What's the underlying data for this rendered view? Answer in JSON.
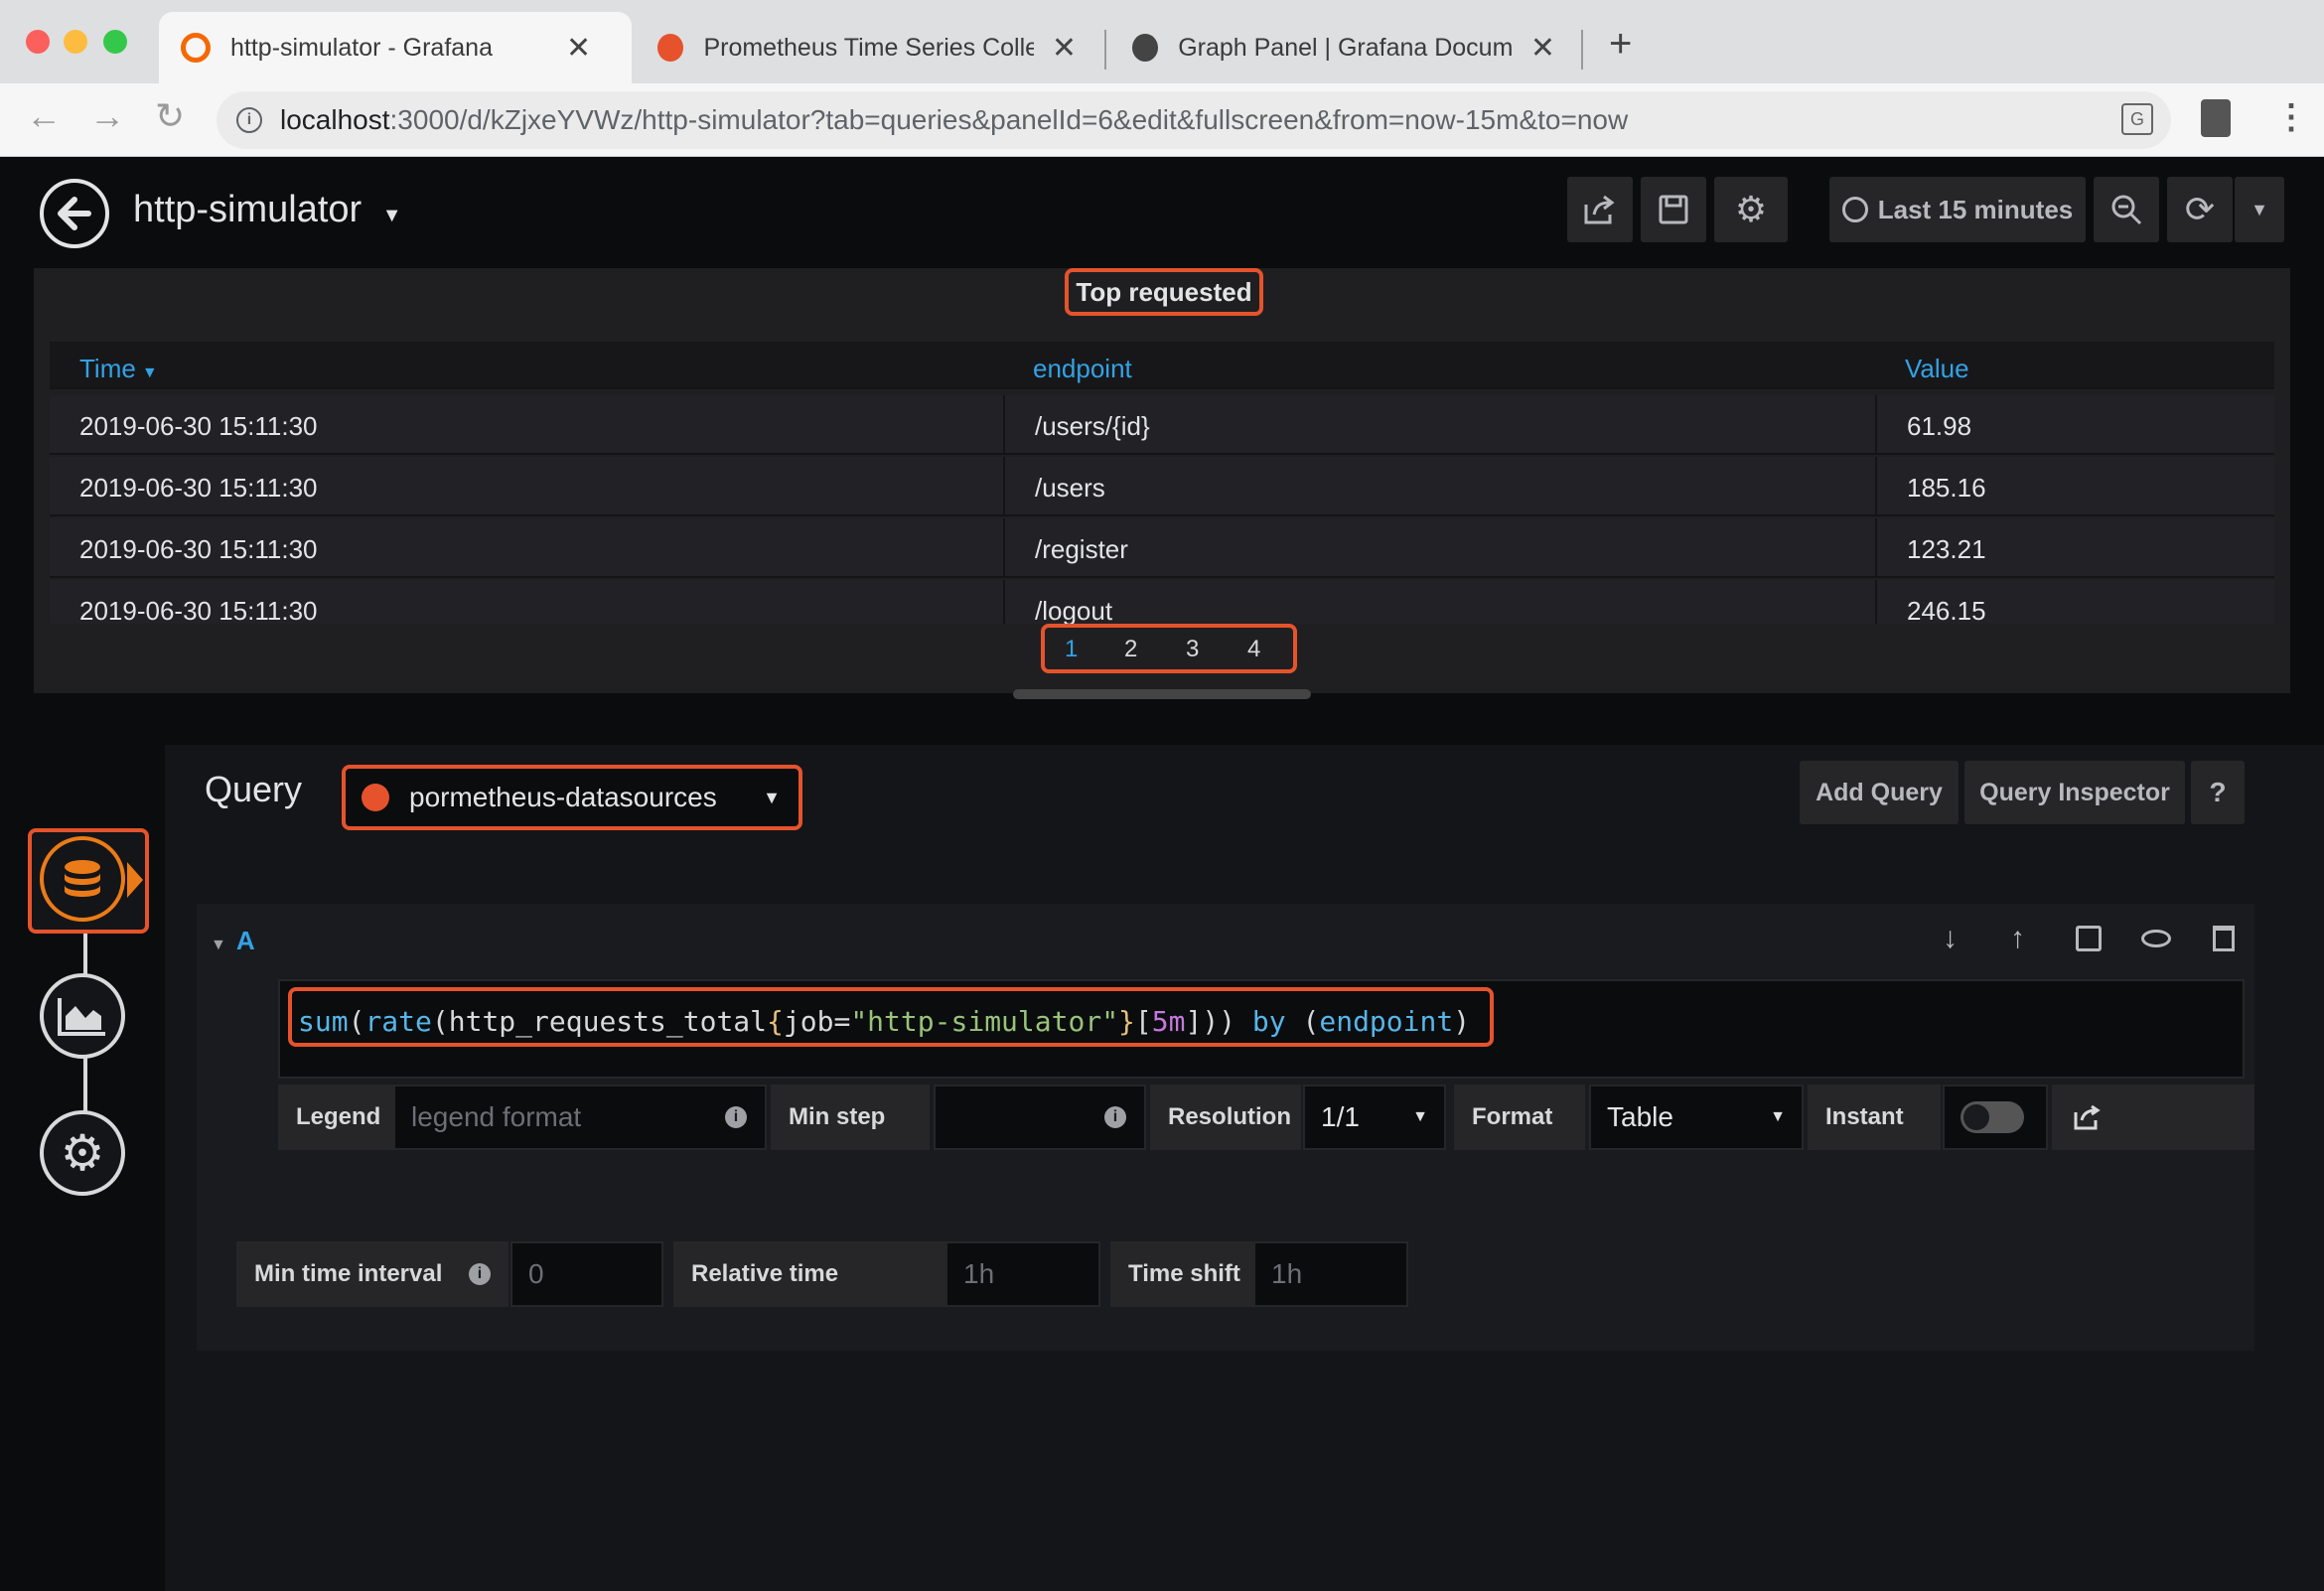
{
  "browser": {
    "tabs": [
      {
        "title": "http-simulator - Grafana",
        "icon": "grafana-logo-icon",
        "active": true
      },
      {
        "title": "Prometheus Time Series Collec",
        "icon": "prometheus-logo-icon",
        "active": false
      },
      {
        "title": "Graph Panel | Grafana Docume",
        "icon": "globe-icon",
        "active": false
      }
    ],
    "url_host": "localhost",
    "url_rest": ":3000/d/kZjxeYVWz/http-simulator?tab=queries&panelId=6&edit&fullscreen&from=now-15m&to=now"
  },
  "dashboard": {
    "title": "http-simulator",
    "time_range": "Last 15 minutes"
  },
  "panel": {
    "title": "Top requested",
    "columns": [
      "Time",
      "endpoint",
      "Value"
    ],
    "rows": [
      [
        "2019-06-30 15:11:30",
        "/users/{id}",
        "61.98"
      ],
      [
        "2019-06-30 15:11:30",
        "/users",
        "185.16"
      ],
      [
        "2019-06-30 15:11:30",
        "/register",
        "123.21"
      ],
      [
        "2019-06-30 15:11:30",
        "/logout",
        "246.15"
      ]
    ],
    "pages": [
      "1",
      "2",
      "3",
      "4"
    ],
    "active_page": "1"
  },
  "editor": {
    "query_label": "Query",
    "datasource": "pormetheus-datasources",
    "add_query": "Add Query",
    "query_inspector": "Query Inspector",
    "help": "?",
    "query_ref": "A",
    "query_tokens": [
      {
        "t": "sum",
        "c": "#56b6e8"
      },
      {
        "t": "(",
        "c": "#d8d9da"
      },
      {
        "t": "rate",
        "c": "#56b6e8"
      },
      {
        "t": "(",
        "c": "#d8d9da"
      },
      {
        "t": "http_requests_total",
        "c": "#d8d9da"
      },
      {
        "t": "{",
        "c": "#e5c07b"
      },
      {
        "t": "job",
        "c": "#d8d9da"
      },
      {
        "t": "=",
        "c": "#d8d9da"
      },
      {
        "t": "\"http-simulator\"",
        "c": "#98c379"
      },
      {
        "t": "}",
        "c": "#e5c07b"
      },
      {
        "t": "[",
        "c": "#d8d9da"
      },
      {
        "t": "5m",
        "c": "#c678dd"
      },
      {
        "t": "]",
        "c": "#d8d9da"
      },
      {
        "t": ")) ",
        "c": "#d8d9da"
      },
      {
        "t": "by ",
        "c": "#56b6e8"
      },
      {
        "t": "(",
        "c": "#d8d9da"
      },
      {
        "t": "endpoint",
        "c": "#56b6e8"
      },
      {
        "t": ")",
        "c": "#d8d9da"
      }
    ],
    "legend_label": "Legend",
    "legend_placeholder": "legend format",
    "min_step_label": "Min step",
    "resolution_label": "Resolution",
    "resolution_value": "1/1",
    "format_label": "Format",
    "format_value": "Table",
    "instant_label": "Instant",
    "min_time_interval_label": "Min time interval",
    "min_time_interval_placeholder": "0",
    "relative_time_label": "Relative time",
    "relative_time_placeholder": "1h",
    "time_shift_label": "Time shift",
    "time_shift_placeholder": "1h"
  },
  "colors": {
    "accent": "#eb7b18",
    "link": "#33a2e5",
    "highlight": "#e5532c"
  }
}
